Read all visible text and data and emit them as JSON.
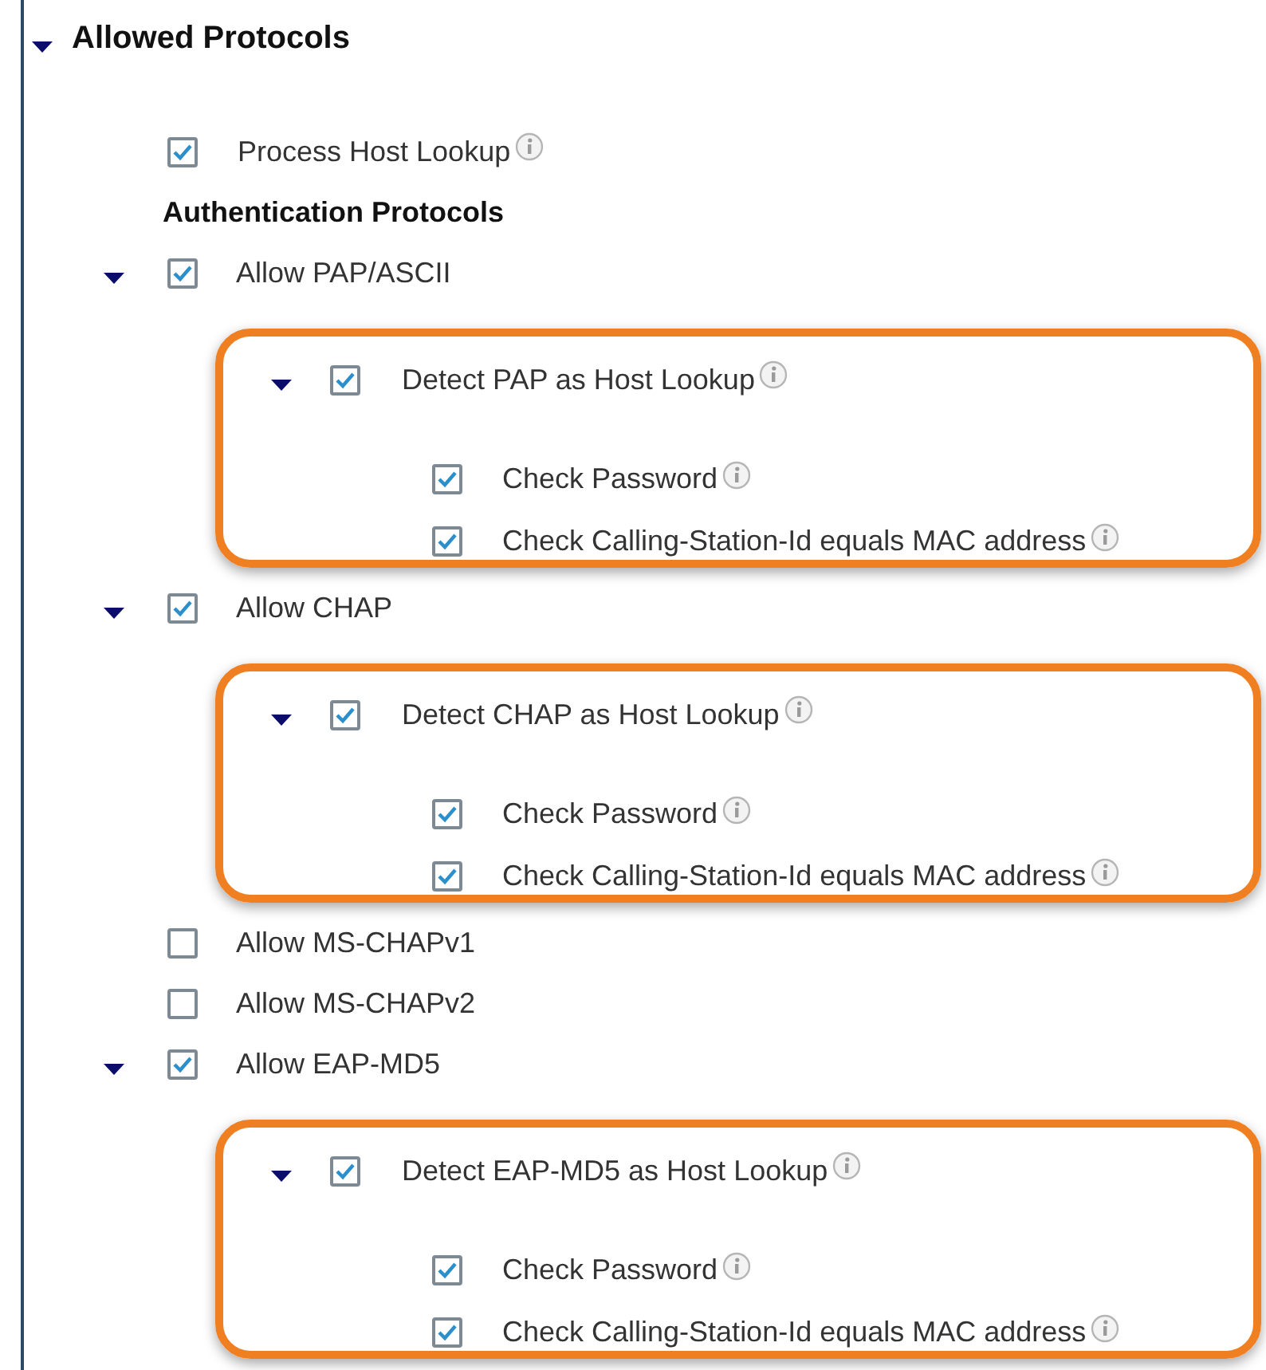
{
  "section": {
    "title": "Allowed Protocols",
    "expanded": true
  },
  "process_host_lookup": {
    "label": "Process Host Lookup",
    "checked": true
  },
  "subheading": "Authentication Protocols",
  "protocols": [
    {
      "label": "Allow PAP/ASCII",
      "checked": true,
      "expanded": true,
      "detect": {
        "label": "Detect PAP as Host Lookup",
        "checked": true,
        "expanded": true,
        "highlighted": true,
        "options": [
          {
            "label": "Check Password",
            "checked": true
          },
          {
            "label": "Check Calling-Station-Id equals MAC address",
            "checked": true
          }
        ]
      }
    },
    {
      "label": "Allow CHAP",
      "checked": true,
      "expanded": true,
      "detect": {
        "label": "Detect CHAP as Host Lookup",
        "checked": true,
        "expanded": true,
        "highlighted": true,
        "options": [
          {
            "label": "Check Password",
            "checked": true
          },
          {
            "label": "Check Calling-Station-Id equals MAC address",
            "checked": true
          }
        ]
      }
    },
    {
      "label": "Allow MS-CHAPv1",
      "checked": false
    },
    {
      "label": "Allow MS-CHAPv2",
      "checked": false
    },
    {
      "label": "Allow EAP-MD5",
      "checked": true,
      "expanded": true,
      "detect": {
        "label": "Detect EAP-MD5 as Host Lookup",
        "checked": true,
        "expanded": true,
        "highlighted": true,
        "options": [
          {
            "label": "Check Password",
            "checked": true
          },
          {
            "label": "Check Calling-Station-Id equals MAC address",
            "checked": true
          }
        ]
      }
    }
  ]
}
